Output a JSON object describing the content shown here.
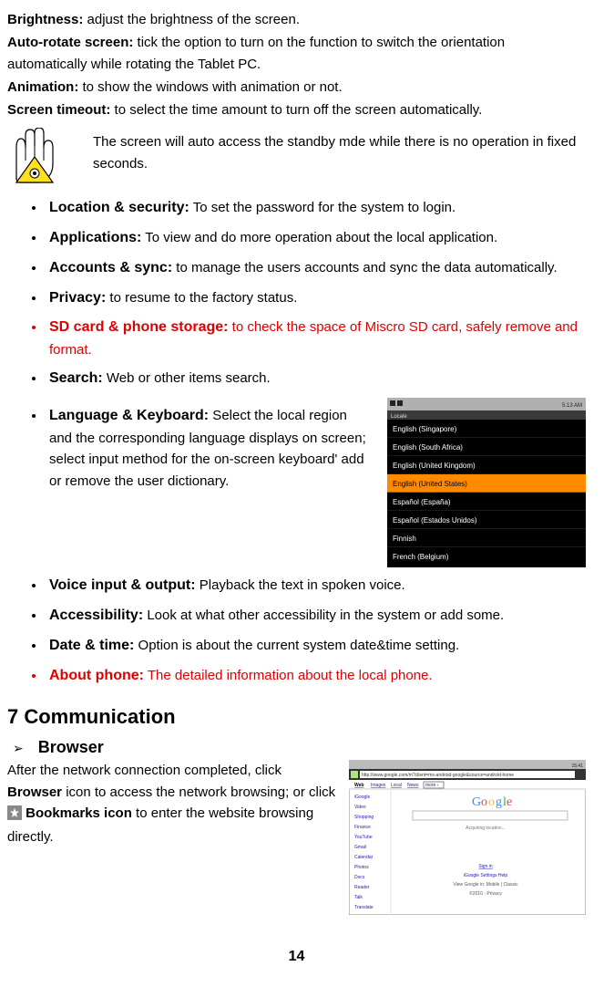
{
  "defs": {
    "brightness_l": "Brightness:",
    "brightness_t": " adjust the brightness of the screen.",
    "autorotate_l": "Auto-rotate screen:",
    "autorotate_t": " tick the option to turn on the function to switch the orientation automatically while rotating the Tablet PC.",
    "animation_l": "Animation:",
    "animation_t": " to show the windows with animation or not.",
    "timeout_l": "Screen timeout:",
    "timeout_t": " to select the time amount to turn off the screen automatically."
  },
  "warn": "The screen will auto access the standby mde while there is no operation in fixed seconds.",
  "items1": [
    {
      "l": "Location & security:",
      "t": " To set the password for the system to login.",
      "red": false
    },
    {
      "l": "Applications:",
      "t": " To view and do more operation about the local application.",
      "red": false
    },
    {
      "l": "Accounts & sync:",
      "t": " to manage the users accounts and sync the data automatically.",
      "red": false
    },
    {
      "l": "Privacy:",
      "t": " to resume to the factory status.",
      "red": false
    },
    {
      "l": "SD card & phone storage:",
      "t": " to check the space of Miscro SD card, safely remove and format.",
      "red": true
    },
    {
      "l": "Search:",
      "t": " Web or other items search.",
      "red": false
    }
  ],
  "langkb": {
    "l": "Language & Keyboard:",
    "t": " Select the local region and the corresponding language displays on screen; select input method for the on-screen keyboard' add or remove the user dictionary.",
    "list": [
      "English (Singapore)",
      "English (South Africa)",
      "English (United Kingdom)",
      "English (United States)",
      "Español (España)",
      "Español (Estados Unidos)",
      "Finnish",
      "French (Belgium)"
    ],
    "selected": 3,
    "time": "5:13 AM"
  },
  "items2": [
    {
      "l": "Voice input & output:",
      "t": " Playback the text in spoken voice.",
      "red": false
    },
    {
      "l": "Accessibility:",
      "t": " Look at what other accessibility in the system or add some.",
      "red": false
    },
    {
      "l": "Date & time:",
      "t": " Option is about the current system date&time setting.",
      "red": false
    },
    {
      "l": "About phone:",
      "t": " The detailed information about the local phone.",
      "red": true
    }
  ],
  "section": "7 Communication",
  "subsection": "Browser",
  "browser": {
    "p1a": "After the network connection completed, click ",
    "p1b": "Browser",
    "p1c": " icon to access the network browsing; or click ",
    "p2a": "Bookmarks icon",
    "p2b": " to enter the website browsing directly.",
    "url": "http://www.google.com/m?client=ms-android-google&source=android-home",
    "tabs": [
      "Web",
      "Images",
      "Local",
      "News",
      "more ›"
    ],
    "side": [
      "iGoogle",
      "Video",
      "Shopping",
      "Finance",
      "YouTube",
      "Gmail",
      "Calendar",
      "Photos",
      "Docs",
      "Reader",
      "Talk",
      "Translate"
    ],
    "brand": "Google",
    "loading": "Acquiring location...",
    "signin": "Sign in",
    "help1": "iGoogle   Settings   Help",
    "help2": "View Google in: Mobile | Classic",
    "help3": "©2010 - Privacy",
    "time": "15:41"
  },
  "page": "14"
}
